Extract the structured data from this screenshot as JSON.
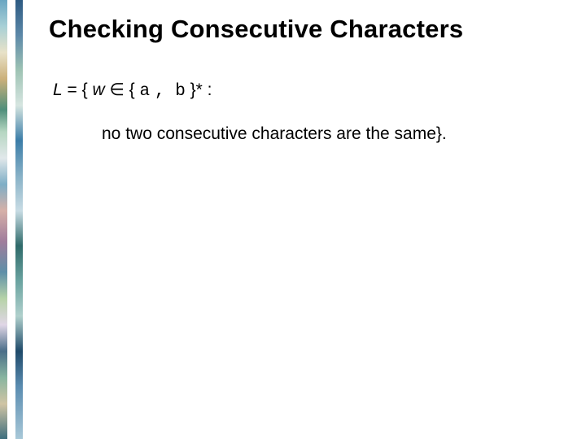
{
  "title": "Checking Consecutive Characters",
  "def": {
    "lvar": "L",
    "eq": " = {",
    "wvar": "w",
    "elem": " ∈ {",
    "alpha_a": "a",
    "sep": ", ",
    "alpha_b": "b",
    "tail": "}* :"
  },
  "condition": "no two consecutive characters are the same}."
}
